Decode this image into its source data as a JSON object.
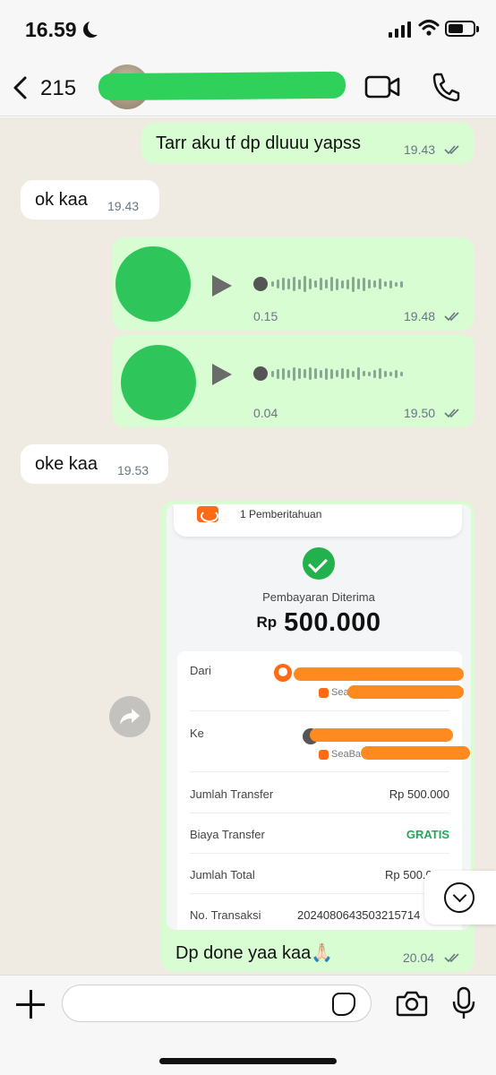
{
  "status_bar": {
    "time": "16.59",
    "moon_icon": "moon-icon",
    "signal_icon": "cellular-signal-icon",
    "wifi_icon": "wifi-icon",
    "battery_icon": "battery-icon",
    "battery_level": 0.55
  },
  "header": {
    "back_icon": "chevron-left-icon",
    "back_count": "215",
    "video_icon": "video-camera-icon",
    "phone_icon": "phone-icon"
  },
  "colors": {
    "outgoing_bubble": "#d9fdd3",
    "incoming_bubble": "#ffffff",
    "chat_background": "#efeae2",
    "voice_avatar": "#2ec55a",
    "accent_green": "#22b14c",
    "bank_orange": "#ff6a13"
  },
  "messages": [
    {
      "direction": "out",
      "text": "Tarr aku tf dp dluuu yapss",
      "time": "19.43",
      "read": true
    },
    {
      "direction": "in",
      "text": "ok kaa",
      "time": "19.43"
    },
    {
      "direction": "out",
      "type": "voice",
      "duration": "0.15",
      "time": "19.48",
      "read": true
    },
    {
      "direction": "out",
      "type": "voice",
      "duration": "0.04",
      "time": "19.50",
      "read": true
    },
    {
      "direction": "in",
      "text": "oke kaa",
      "time": "19.53"
    },
    {
      "direction": "out",
      "type": "image",
      "caption": "Dp done yaa kaa🙏🏻",
      "time": "20.04",
      "read": true
    }
  ],
  "receipt": {
    "notification": "1 Pemberitahuan",
    "status": "Pembayaran Diterima",
    "currency": "Rp",
    "amount": "500.000",
    "from_label": "Dari",
    "from_bank": "Sea",
    "to_label": "Ke",
    "to_bank": "SeaBa",
    "rows": [
      {
        "label": "Jumlah Transfer",
        "value": "Rp 500.000"
      },
      {
        "label": "Biaya Transfer",
        "value": "GRATIS"
      },
      {
        "label": "Jumlah Total",
        "value": "Rp 500.0"
      },
      {
        "label": "No. Transaksi",
        "value": "2024080643503215714"
      }
    ]
  },
  "buttons": {
    "forward_icon": "forward-share-icon",
    "scroll_down_icon": "chevron-down-circle-icon"
  },
  "input_bar": {
    "plus_icon": "plus-icon",
    "message_value": "",
    "sticker_icon": "sticker-icon",
    "camera_icon": "camera-icon",
    "mic_icon": "microphone-icon"
  }
}
